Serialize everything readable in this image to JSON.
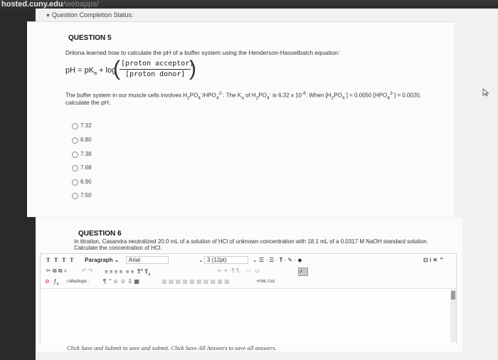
{
  "browser": {
    "url_host": "hosted.cuny.edu",
    "url_tail": "/webapps/"
  },
  "status_bar": {
    "label": "Question Completion Status:"
  },
  "question5": {
    "title": "QUESTION 5",
    "intro": "Drilona learned how to calculate the pH of a buffer system using the Henderson-Hasselbalch equation:",
    "eq_lhs": "pH = pKa + log",
    "numerator": "[proton acceptor]",
    "denominator": "[proton donor]",
    "body_line1": "The buffer system in our muscle cells involves H2PO4-/HPO42-. The Ka of H2PO4- is 6.32 x 10-8. When [H2PO4-] = 0.0050 [HPO42-] = 0.0020,",
    "body_line2": "calculate the pH.",
    "choices": [
      "7.32",
      "6.80",
      "7.38",
      "7.68",
      "6.90",
      "7.50"
    ]
  },
  "question6": {
    "title": "QUESTION 6",
    "text_line1": "In titration, Casandra neutralized 20.0 mL of a solution of HCl of unknown concentration with 18.1 mL of a 0.0317 M NaOH standard solution.",
    "text_line2": "Calculate the concentration of HCl."
  },
  "editor": {
    "paragraph": "Paragraph",
    "font": "Arial",
    "size": "3 (12pt)",
    "mashups": "Mashups",
    "html_label": "HTML CSS"
  },
  "footer": {
    "text": "Click Save and Submit to save and submit. Click Save All Answers to save all answers."
  }
}
